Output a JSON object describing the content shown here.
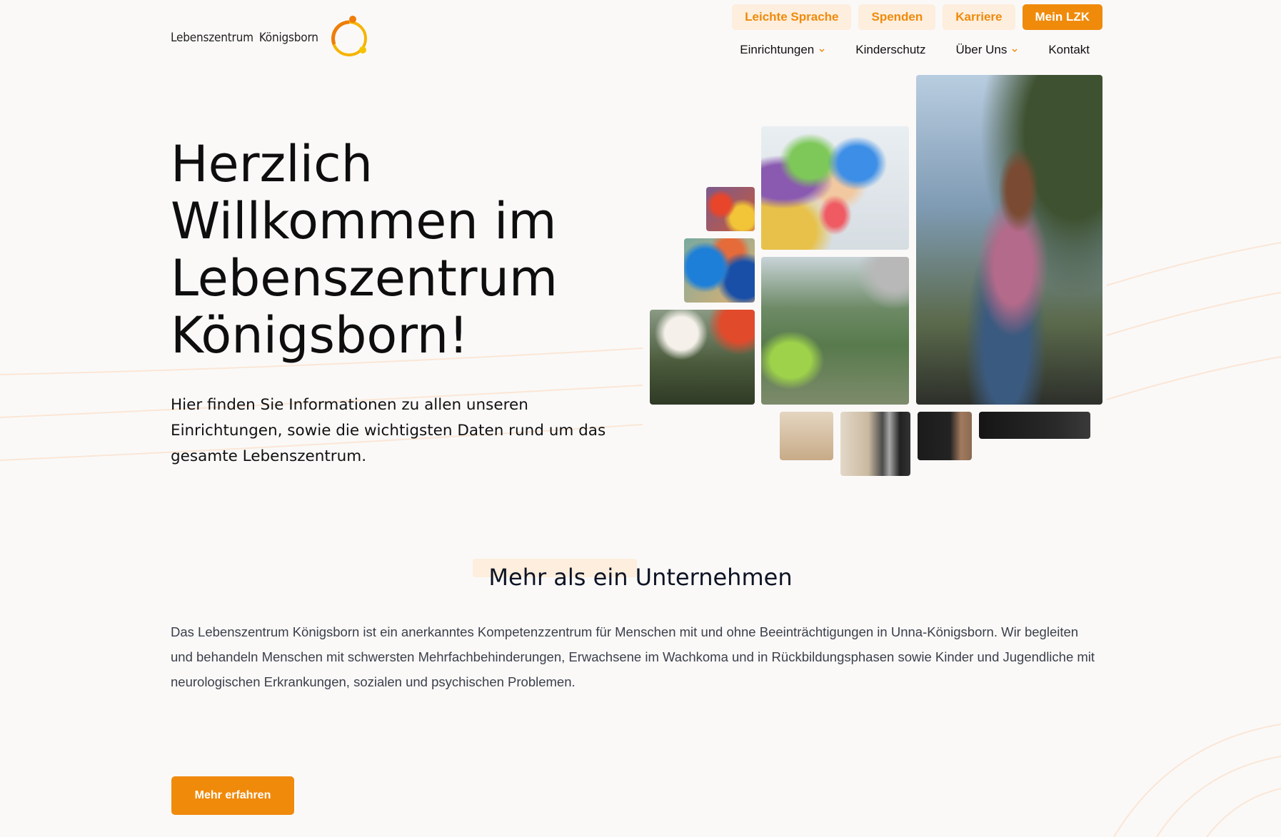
{
  "brand": {
    "logo_word1": "Lebenszentrum",
    "logo_word2": "Königsborn",
    "accent_color": "#f08a0b",
    "accent_light": "#fdeedd"
  },
  "top_buttons": {
    "easy_language": "Leichte Sprache",
    "donate": "Spenden",
    "career": "Karriere",
    "my_lzk": "Mein LZK"
  },
  "nav": {
    "facilities": "Einrichtungen",
    "child_protection": "Kinderschutz",
    "about": "Über Uns",
    "contact": "Kontakt"
  },
  "hero": {
    "title_lines": [
      "Herzlich",
      "Willkommen im",
      "Lebenszentrum",
      "Königsborn!"
    ],
    "text": "Hier finden Sie Informationen zu allen unseren Einrichtungen, sowie die wichtigsten Daten rund um das gesamte Lebenszentrum."
  },
  "about": {
    "title": "Mehr als ein Unternehmen",
    "text": "Das Lebenszentrum Königsborn ist ein anerkanntes Kompetenzzentrum für Menschen mit und ohne Beeinträchtigungen in Unna-Königsborn. Wir begleiten und behandeln Menschen mit schwersten Mehrfachbehinderungen, Erwachsene im Wachkoma und in Rückbildungsphasen sowie Kinder und Jugendliche mit neurologischen Erkrankungen, sozialen und psychischen Problemen.",
    "cta": "Mehr erfahren"
  }
}
